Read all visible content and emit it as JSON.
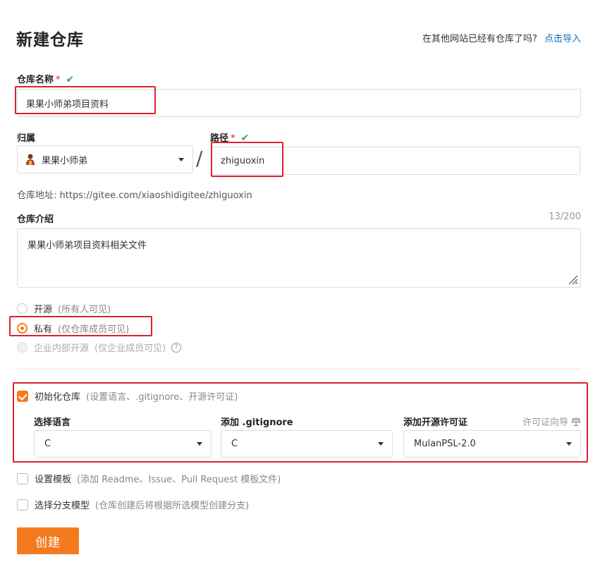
{
  "header": {
    "title": "新建仓库",
    "import_question": "在其他网站已经有仓库了吗?",
    "import_link": "点击导入"
  },
  "repo_name": {
    "label": "仓库名称",
    "required_mark": "*",
    "check_mark": "✔",
    "value": "果果小师弟项目资料"
  },
  "owner": {
    "label": "归属",
    "value": "果果小师弟",
    "avatar_icon": "user-avatar-icon"
  },
  "path": {
    "separator": "/",
    "label": "路径",
    "required_mark": "*",
    "check_mark": "✔",
    "value": "zhiguoxin"
  },
  "repo_address": {
    "label": "仓库地址:",
    "url": "https://gitee.com/xiaoshidigitee/zhiguoxin"
  },
  "description": {
    "label": "仓库介绍",
    "counter": "13/200",
    "value": "果果小师弟项目资料相关文件"
  },
  "visibility": {
    "options": [
      {
        "label": "开源",
        "hint": "(所有人可见)",
        "state": "unchecked"
      },
      {
        "label": "私有",
        "hint": "(仅仓库成员可见)",
        "state": "checked"
      },
      {
        "label": "企业内部开源",
        "hint": "(仅企业成员可见)",
        "state": "disabled"
      }
    ],
    "help_icon": "?"
  },
  "init": {
    "label": "初始化仓库",
    "hint": "(设置语言、.gitignore、开源许可证)",
    "checked": true,
    "language": {
      "label": "选择语言",
      "value": "C"
    },
    "gitignore": {
      "label": "添加 .gitignore",
      "value": "C"
    },
    "license": {
      "label": "添加开源许可证",
      "value": "MulanPSL-2.0",
      "guide_label": "许可证向导",
      "guide_icon": "scale-icon"
    }
  },
  "template": {
    "label": "设置模板",
    "hint": "(添加 Readme、Issue、Pull Request 模板文件)",
    "checked": false
  },
  "branch_model": {
    "label": "选择分支模型",
    "hint": "(仓库创建后将根据所选模型创建分支)",
    "checked": false
  },
  "create_button": "创建",
  "colors": {
    "accent": "#f47a20",
    "link": "#0b6fc5",
    "highlight_box": "#e02030",
    "check": "#2eaa4a"
  }
}
